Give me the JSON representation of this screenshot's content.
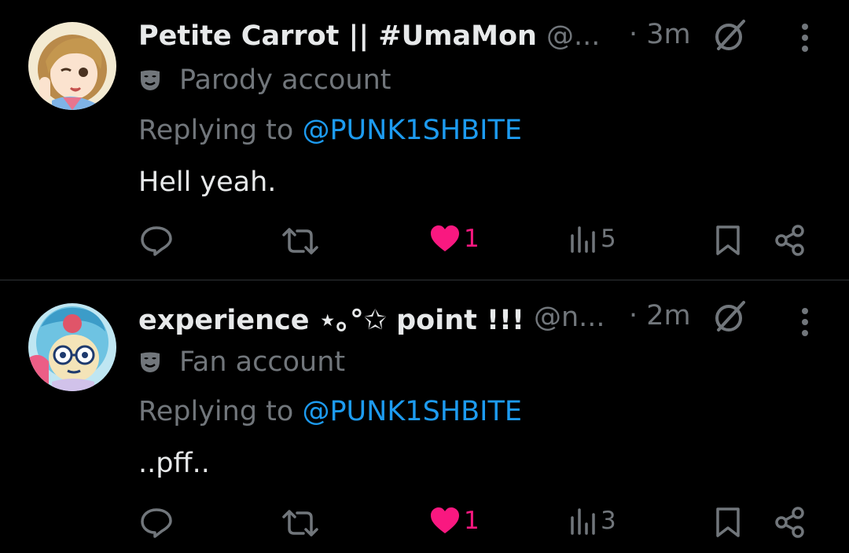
{
  "tweets": [
    {
      "display_name": "Petite Carrot || #UmaMon",
      "handle": "@...",
      "time": "· 3m",
      "account_label": "Parody account",
      "replying_prefix": "Replying to ",
      "replying_to": "@PUNK1SHBITE",
      "text": "Hell yeah.",
      "like_count": "1",
      "view_count": "5",
      "avatar_icon": "avatar-anime-girl",
      "account_icon": "mask-icon"
    },
    {
      "display_name": "experience ⋆｡°✩ point !!!",
      "handle": "@n...",
      "time": "· 2m",
      "account_label": "Fan account",
      "replying_prefix": "Replying to ",
      "replying_to": "@PUNK1SHBITE",
      "text": "..pff..",
      "like_count": "1",
      "view_count": "3",
      "avatar_icon": "avatar-glasses-character",
      "account_icon": "mask-icon"
    }
  ],
  "colors": {
    "background": "#000000",
    "text_primary": "#e7e9ea",
    "text_secondary": "#71767b",
    "link": "#1d9bf0",
    "like": "#f91880",
    "divider": "#2f3336"
  }
}
